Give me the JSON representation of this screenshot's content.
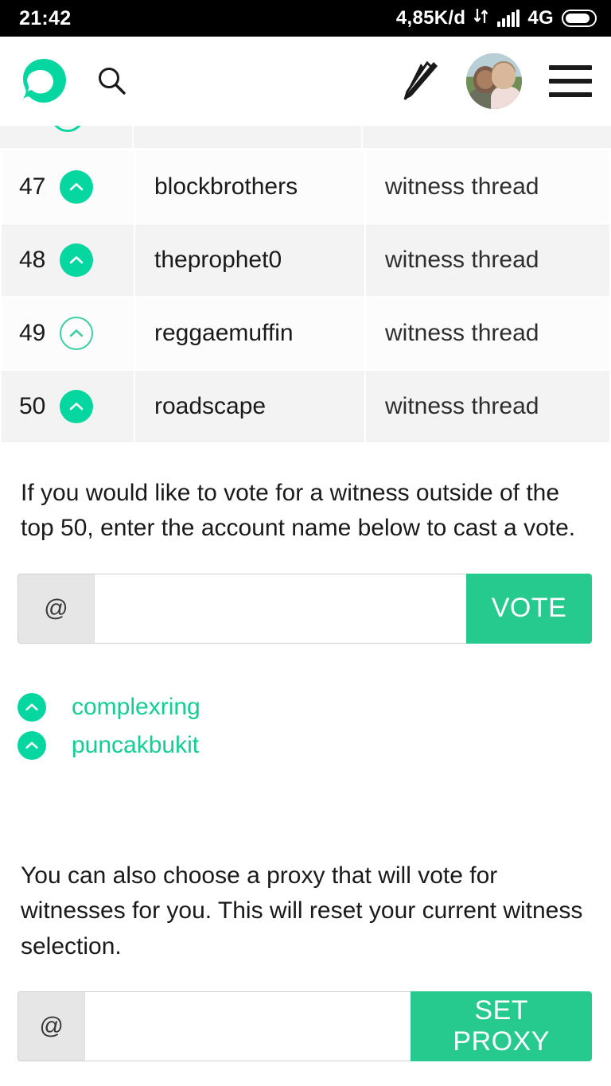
{
  "statusbar": {
    "time": "21:42",
    "data_speed": "4,85K/d",
    "network": "4G",
    "icons": [
      "data-transfer-icon",
      "signal-bars-icon",
      "battery-icon"
    ]
  },
  "appbar": {
    "logo": "steemit-logo",
    "search_icon": "search-icon",
    "compose_icon": "pen-icon",
    "avatar": "user-avatar",
    "menu_icon": "hamburger-menu-icon"
  },
  "witness_table": {
    "rows": [
      {
        "rank": "47",
        "name": "blockbrothers",
        "link": "witness thread",
        "voted": true
      },
      {
        "rank": "48",
        "name": "theprophet0",
        "link": "witness thread",
        "voted": true
      },
      {
        "rank": "49",
        "name": "reggaemuffin",
        "link": "witness thread",
        "voted": false
      },
      {
        "rank": "50",
        "name": "roadscape",
        "link": "witness thread",
        "voted": true
      }
    ]
  },
  "vote_section": {
    "description": "If you would like to vote for a witness outside of the top 50, enter the account name below to cast a vote.",
    "at_symbol": "@",
    "input_value": "",
    "input_placeholder": "",
    "button_label": "VOTE"
  },
  "voted_witnesses": {
    "items": [
      {
        "name": "complexring"
      },
      {
        "name": "puncakbukit"
      }
    ]
  },
  "proxy_section": {
    "description": "You can also choose a proxy that will vote for witnesses for you. This will reset your current witness selection.",
    "at_symbol": "@",
    "input_value": "",
    "input_placeholder": "",
    "button_label": "SET PROXY"
  },
  "colors": {
    "brand_green": "#06d6a0",
    "button_green": "#26c98e",
    "link_green": "#11cf93",
    "row_shade": "#f3f3f3",
    "text_dark": "#1a1a1a"
  }
}
